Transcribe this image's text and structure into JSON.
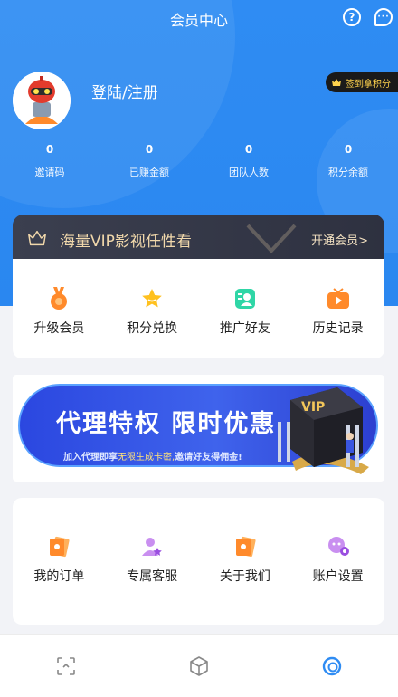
{
  "header": {
    "title": "会员中心",
    "help_icon": "help-icon",
    "chat_icon": "chat-icon"
  },
  "profile": {
    "login_label": "登陆/注册",
    "checkin_label": "签到拿积分"
  },
  "stats": [
    {
      "value": "0",
      "label": "邀请码"
    },
    {
      "value": "0",
      "label": "已赚金额"
    },
    {
      "value": "0",
      "label": "团队人数"
    },
    {
      "value": "0",
      "label": "积分余额"
    }
  ],
  "vip_banner": {
    "title": "海量VIP影视任性看",
    "action": "开通会员>"
  },
  "menu_primary": [
    {
      "label": "升级会员",
      "icon": "medal-icon"
    },
    {
      "label": "积分兑换",
      "icon": "star-icon"
    },
    {
      "label": "推广好友",
      "icon": "share-user-icon"
    },
    {
      "label": "历史记录",
      "icon": "play-history-icon"
    }
  ],
  "promo": {
    "title": "代理特权  限时优惠",
    "subtitle_prefix": "加入代理即享",
    "subtitle_highlight": "无限生成卡密,",
    "subtitle_suffix": "邀请好友得佣金!",
    "badge": "VIP"
  },
  "menu_secondary": [
    {
      "label": "我的订单",
      "icon": "order-icon"
    },
    {
      "label": "专属客服",
      "icon": "customer-service-icon"
    },
    {
      "label": "关于我们",
      "icon": "about-icon"
    },
    {
      "label": "账户设置",
      "icon": "settings-icon"
    }
  ],
  "tabbar": [
    {
      "icon": "scan-icon",
      "active": false
    },
    {
      "icon": "cube-icon",
      "active": false
    },
    {
      "icon": "profile-ring-icon",
      "active": true
    }
  ],
  "colors": {
    "primary": "#2f8cf3",
    "vip_gold": "#f1d8ab",
    "orange": "#ff8a2b"
  }
}
